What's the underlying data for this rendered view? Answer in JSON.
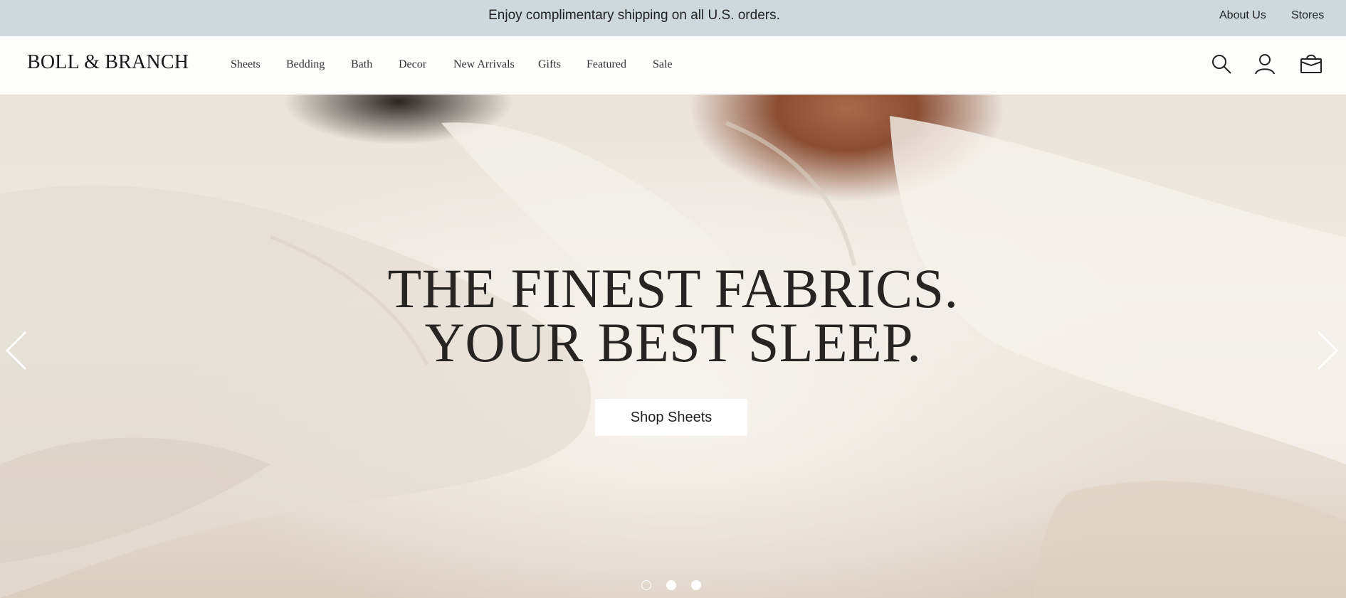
{
  "announcement": {
    "text": "Enjoy complimentary shipping on all U.S. orders.",
    "links": [
      "About Us",
      "Stores"
    ]
  },
  "header": {
    "logo": "BOLL & BRANCH",
    "nav": [
      "Sheets",
      "Bedding",
      "Bath",
      "Decor",
      "New Arrivals",
      "Gifts",
      "Featured",
      "Sale"
    ],
    "icons": [
      "search-icon",
      "account-icon",
      "cart-icon"
    ]
  },
  "hero": {
    "heading_line1": "THE FINEST FABRICS.",
    "heading_line2": "YOUR BEST SLEEP.",
    "cta_label": "Shop Sheets",
    "carousel": {
      "slides": 3,
      "active": 1
    }
  },
  "colors": {
    "announcement_bg": "#cdd9dd",
    "header_bg": "#fdfdfc",
    "heading": "#262523",
    "button_bg": "#ffffff"
  }
}
